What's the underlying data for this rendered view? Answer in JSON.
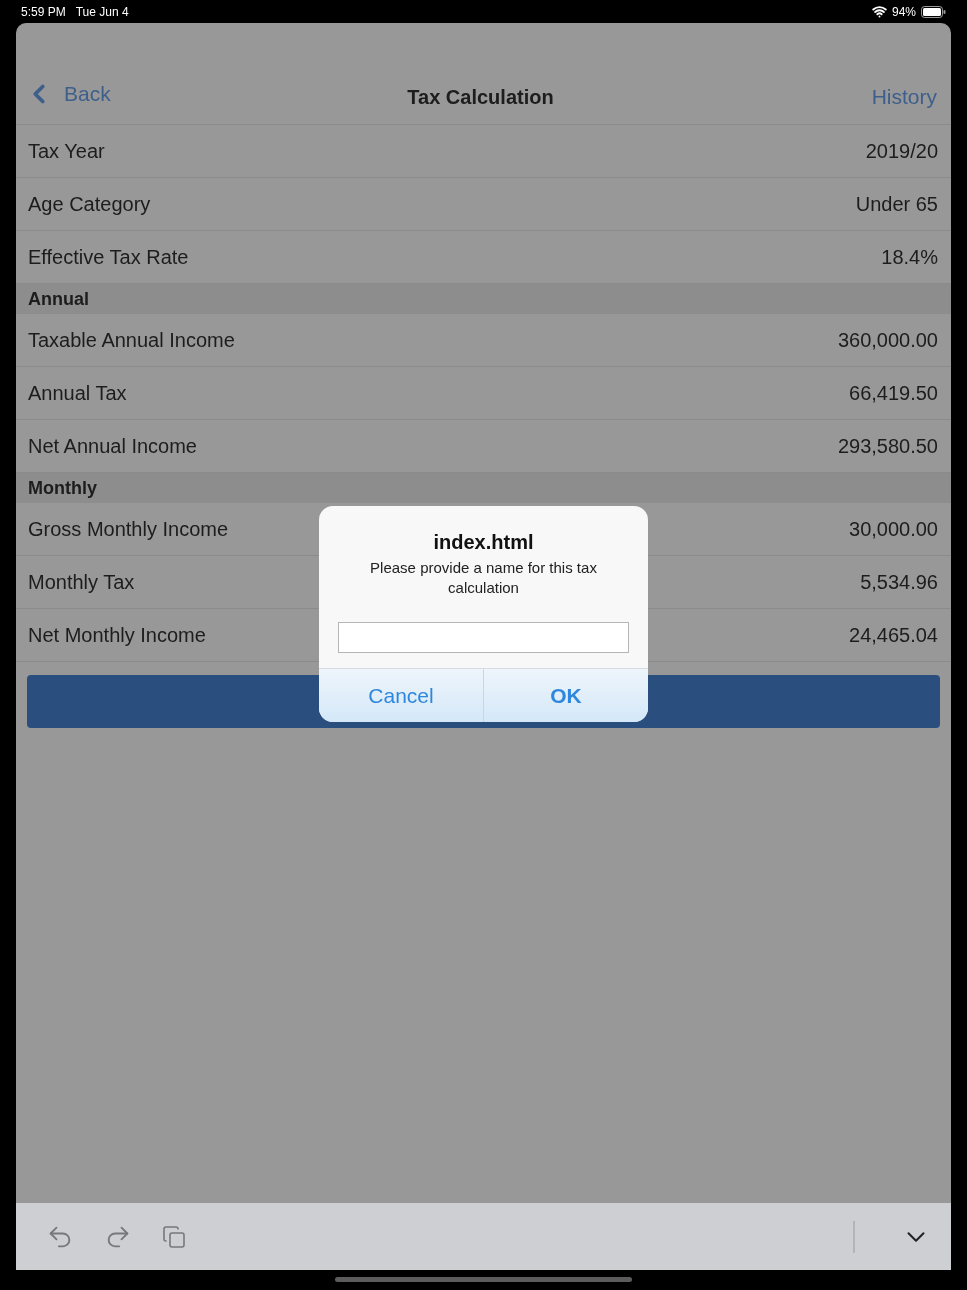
{
  "status_bar": {
    "time": "5:59 PM",
    "date": "Tue Jun 4",
    "battery": "94%"
  },
  "nav": {
    "back": "Back",
    "title": "Tax Calculation",
    "action": "History"
  },
  "sections": [
    {
      "rows": [
        {
          "label": "Tax Year",
          "value": "2019/20"
        },
        {
          "label": "Age Category",
          "value": "Under 65"
        },
        {
          "label": "Effective Tax Rate",
          "value": "18.4%"
        }
      ]
    },
    {
      "header": "Annual",
      "rows": [
        {
          "label": "Taxable Annual Income",
          "value": "360,000.00"
        },
        {
          "label": "Annual Tax",
          "value": "66,419.50"
        },
        {
          "label": "Net Annual Income",
          "value": "293,580.50"
        }
      ]
    },
    {
      "header": "Monthly",
      "rows": [
        {
          "label": "Gross Monthly Income",
          "value": "30,000.00"
        },
        {
          "label": "Monthly Tax",
          "value": "5,534.96"
        },
        {
          "label": "Net Monthly Income",
          "value": "24,465.04"
        }
      ]
    }
  ],
  "dialog": {
    "title": "index.html",
    "message": "Please provide a name for this tax calculation",
    "buttons": [
      {
        "label": "Cancel",
        "kind": "cancel"
      },
      {
        "label": "OK",
        "kind": "default"
      }
    ]
  }
}
